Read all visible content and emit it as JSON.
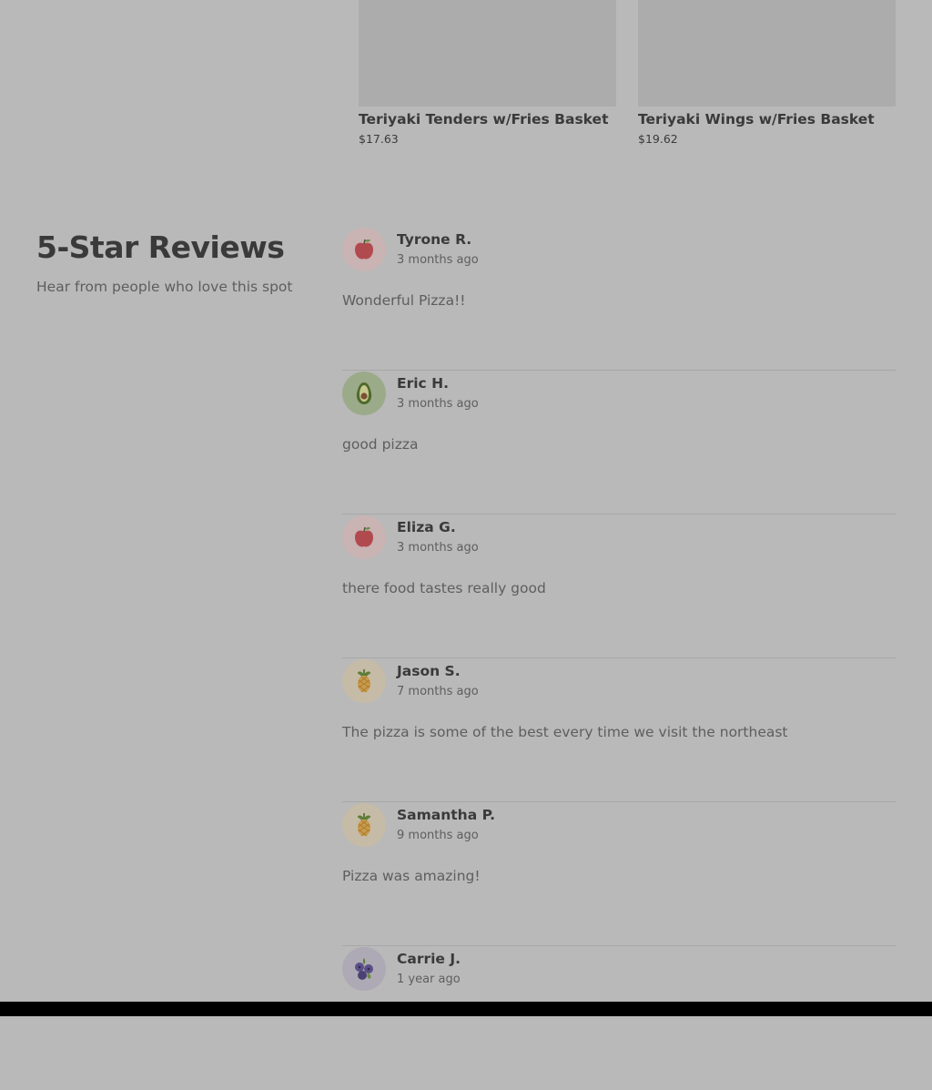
{
  "menu_items": [
    {
      "name": "Teriyaki Tenders w/Fries Basket",
      "price": "$17.63"
    },
    {
      "name": "Teriyaki Wings w/Fries Basket",
      "price": "$19.62"
    }
  ],
  "reviews_section": {
    "title": "5-Star Reviews",
    "subtitle": "Hear from people who love this spot"
  },
  "reviews": [
    {
      "name": "Tyrone R.",
      "time": "3 months ago",
      "text": "Wonderful Pizza!!",
      "avatar_icon": "apple-icon"
    },
    {
      "name": "Eric H.",
      "time": "3 months ago",
      "text": "good pizza",
      "avatar_icon": "avocado-icon"
    },
    {
      "name": "Eliza G.",
      "time": "3 months ago",
      "text": "there food tastes really good",
      "avatar_icon": "apple-icon"
    },
    {
      "name": "Jason S.",
      "time": "7 months ago",
      "text": "The pizza is some of the best every time we visit the northeast",
      "avatar_icon": "pineapple-icon"
    },
    {
      "name": "Samantha P.",
      "time": "9 months ago",
      "text": "Pizza was amazing!",
      "avatar_icon": "pineapple-icon"
    },
    {
      "name": "Carrie J.",
      "time": "1 year ago",
      "text": "",
      "avatar_icon": "blueberry-icon"
    }
  ],
  "colors": {
    "page_background": "#b9b9b9",
    "apple_avatar_bg": "#c9b3b3",
    "avocado_avatar_bg": "#9bab8a",
    "pineapple_avatar_bg": "#c5bba6",
    "blueberry_avatar_bg": "#aeaab5"
  }
}
